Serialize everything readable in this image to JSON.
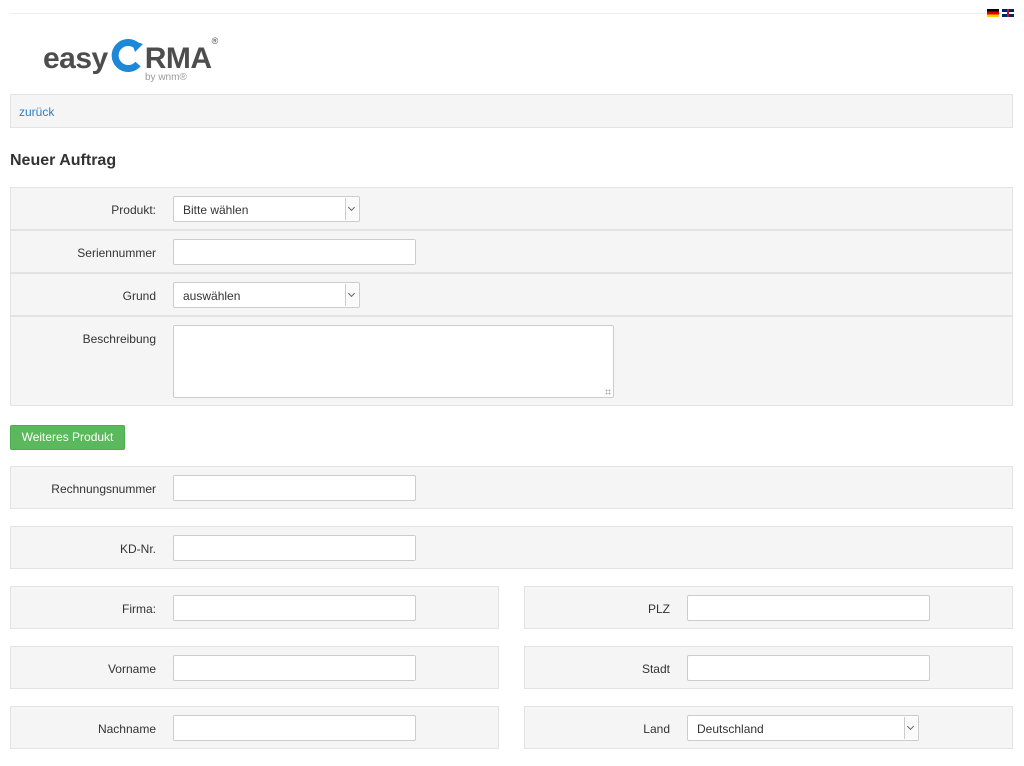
{
  "header": {
    "logo": {
      "part1": "easy",
      "part2": "RMA",
      "registered": "®",
      "byline": "by wnm®"
    },
    "languages": [
      {
        "code": "de",
        "icon": "flag-de-icon"
      },
      {
        "code": "en",
        "icon": "flag-gb-icon"
      }
    ]
  },
  "nav": {
    "back_label": "zurück"
  },
  "page": {
    "title": "Neuer Auftrag"
  },
  "product_section": {
    "produkt": {
      "label": "Produkt:",
      "selected": "Bitte wählen"
    },
    "seriennummer": {
      "label": "Seriennummer",
      "value": ""
    },
    "grund": {
      "label": "Grund",
      "selected": "auswählen"
    },
    "beschreibung": {
      "label": "Beschreibung",
      "value": ""
    }
  },
  "add_product_button": "Weiteres Produkt",
  "invoice": {
    "rechnungsnummer": {
      "label": "Rechnungsnummer",
      "value": ""
    },
    "kdnr": {
      "label": "KD-Nr.",
      "value": ""
    }
  },
  "address": {
    "firma": {
      "label": "Firma:",
      "value": ""
    },
    "vorname": {
      "label": "Vorname",
      "value": ""
    },
    "nachname": {
      "label": "Nachname",
      "value": ""
    },
    "plz": {
      "label": "PLZ",
      "value": ""
    },
    "stadt": {
      "label": "Stadt",
      "value": ""
    },
    "land": {
      "label": "Land",
      "selected": "Deutschland"
    }
  },
  "colors": {
    "accent_green": "#5cb85c",
    "link_blue": "#2a7fc9",
    "logo_blue": "#1e88d8",
    "panel_bg": "#f5f5f5"
  }
}
